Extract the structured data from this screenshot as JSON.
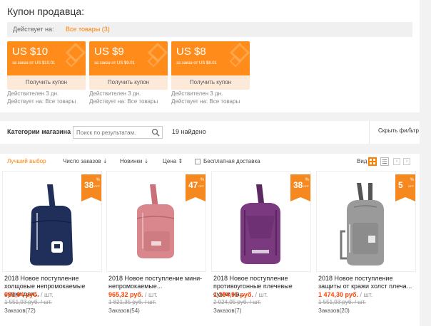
{
  "coupons": {
    "title": "Купон продавца:",
    "scope_label": "Действует на:",
    "scope_value": "Все товары (3)",
    "items": [
      {
        "amount": "US $10",
        "condition": "за заказ от US $10.01",
        "button": "Получить купон",
        "valid": "Действителен 3 дн.",
        "applies": "Действует на: Все товары"
      },
      {
        "amount": "US $9",
        "condition": "за заказ от US $9.01",
        "button": "Получить купон",
        "valid": "Действителен 3 дн.",
        "applies": "Действует на: Все товары"
      },
      {
        "amount": "US $8",
        "condition": "за заказ от US $8.01",
        "button": "Получить купон",
        "valid": "Действителен 3 дн.",
        "applies": "Действует на: Все товары"
      }
    ],
    "color": "#ff8c1a"
  },
  "search": {
    "category_label": "Категории магазина >",
    "placeholder": "Поиск по результатам.",
    "found": "19 найдено",
    "hide_filter": "Скрыть фильтр"
  },
  "sort": {
    "best": "Лучший выбор",
    "orders": "Число заказов",
    "new": "Новинки",
    "price": "Цена",
    "free_shipping": "Бесплатная доставка",
    "view": "Вид"
  },
  "products": [
    {
      "discount": "38",
      "title": "2018 Новое поступление холщовые непромокаемые сумки для...",
      "price": "961,94 руб.",
      "unit": "/ шт.",
      "old_price": "1 551,93 руб.",
      "orders": "Заказов(72)",
      "color": "#1f2f5a"
    },
    {
      "discount": "47",
      "title": "2018 Новое поступление мини-непромокаемые...",
      "price": "965,32 руб.",
      "unit": "/ шт.",
      "old_price": "1 821,35 руб.",
      "orders": "Заказов(54)",
      "color": "#d9868c"
    },
    {
      "discount": "38",
      "title": "2018 Новое поступление противоугонные плечевые сумки на...",
      "price": "1 254,91 руб.",
      "unit": "/ шт.",
      "old_price": "2 024,05 руб.",
      "orders": "Заказов(7)",
      "color": "#7b3a80"
    },
    {
      "discount": "5",
      "title": "2018 Новое поступление защиты от кражи холст плеча...",
      "price": "1 474,30 руб.",
      "unit": "/ шт.",
      "old_price": "1 551,93 руб.",
      "orders": "Заказов(20)",
      "color": "#9a9a9a"
    }
  ],
  "badge_pct": "%",
  "badge_off": "OFF",
  "accent": "#ff7e00"
}
